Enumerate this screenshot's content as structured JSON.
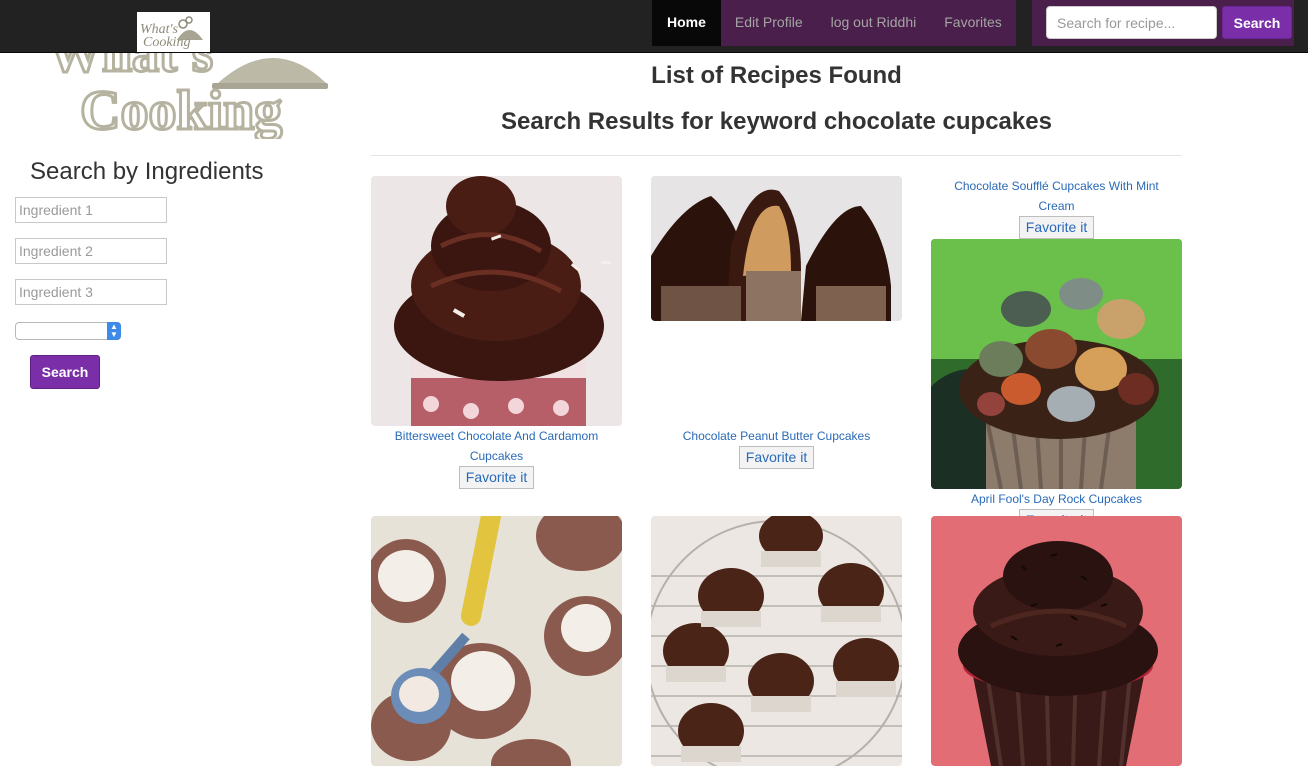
{
  "navbar": {
    "items": [
      {
        "label": "Home",
        "active": true
      },
      {
        "label": "Edit Profile",
        "active": false
      },
      {
        "label": "log out Riddhi",
        "active": false
      },
      {
        "label": "Favorites",
        "active": false
      }
    ],
    "search": {
      "placeholder": "Search for recipe...",
      "button_label": "Search"
    }
  },
  "logo": {
    "alt": "What's Cooking"
  },
  "sidebar": {
    "title": "Search by Ingredients",
    "ingredients": [
      "Ingredient 1",
      "Ingredient 2",
      "Ingredient 3"
    ],
    "select_value": "",
    "search_label": "Search"
  },
  "main": {
    "heading": "List of Recipes Found",
    "subheading": "Search Results for keyword chocolate cupcakes",
    "favorite_label": "Favorite it",
    "recipes": [
      {
        "title": "Bittersweet Chocolate And Cardamom Cupcakes"
      },
      {
        "title": "Chocolate Peanut Butter Cupcakes"
      },
      {
        "title": "Chocolate Soufflé Cupcakes With Mint Cream"
      },
      {
        "title": "April Fool's Day Rock Cupcakes"
      },
      {
        "title": ""
      },
      {
        "title": ""
      },
      {
        "title": ""
      }
    ]
  },
  "colors": {
    "navbar_bg": "#222222",
    "nav_item_bg": "#4a1f4b",
    "accent_purple": "#7a2fa8",
    "link_blue": "#2a6ab7"
  }
}
